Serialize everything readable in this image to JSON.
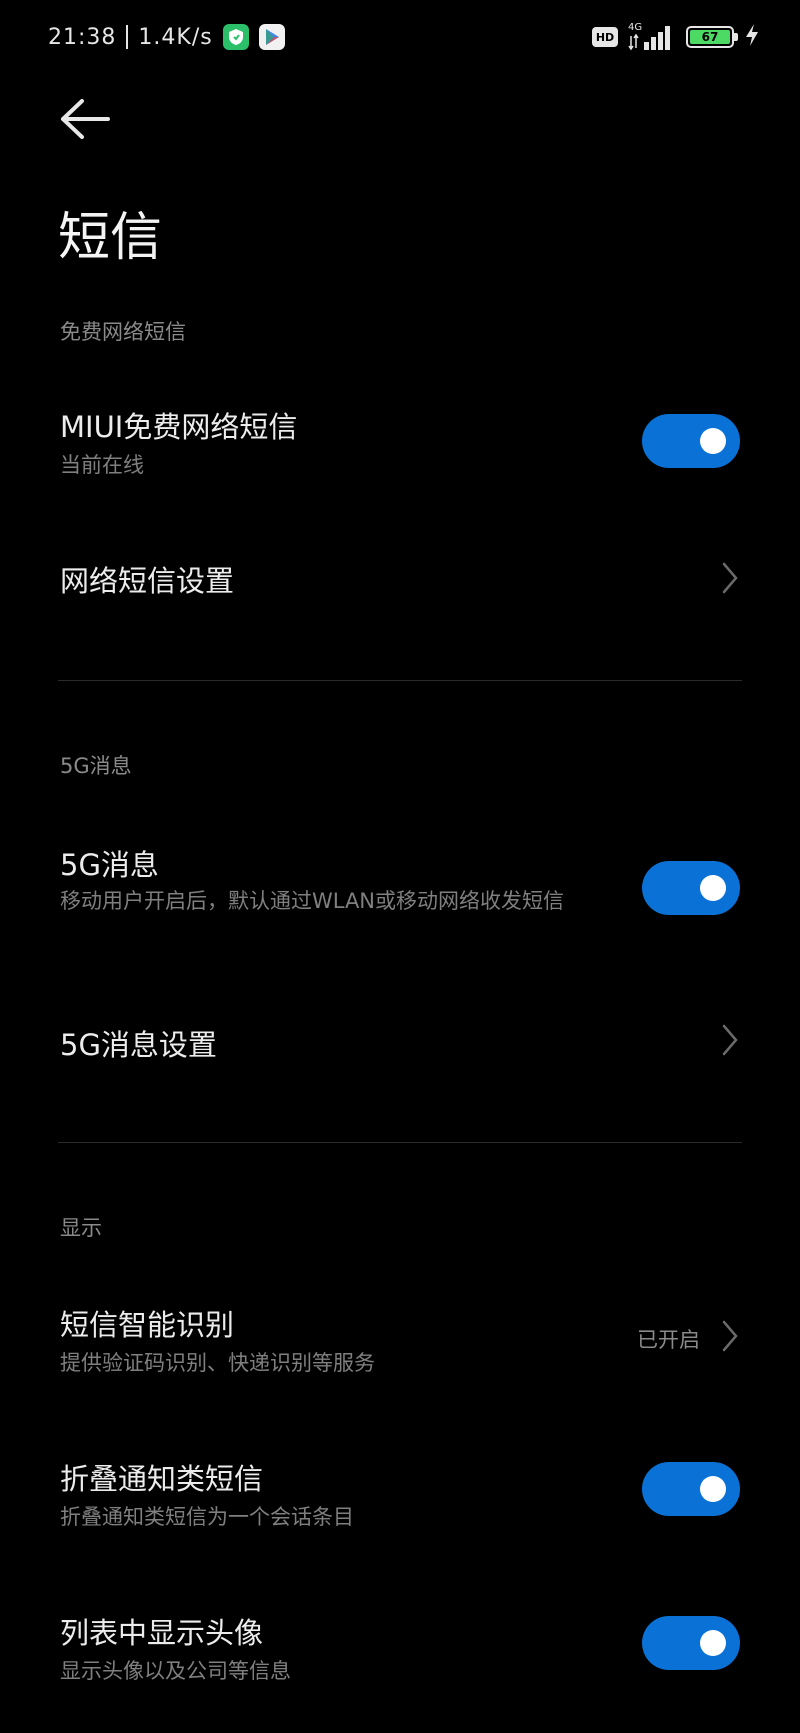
{
  "status_bar": {
    "time": "21:38",
    "speed": "1.4K/s",
    "network": "4G",
    "battery": "67",
    "hd": "HD"
  },
  "header": {
    "title": "短信"
  },
  "sections": {
    "free_sms": {
      "label": "免费网络短信",
      "miui_title": "MIUI免费网络短信",
      "miui_sub": "当前在线",
      "miui_on": true,
      "settings_title": "网络短信设置"
    },
    "fiveg": {
      "label": "5G消息",
      "fiveg_title": "5G消息",
      "fiveg_sub": "移动用户开启后，默认通过WLAN或移动网络收发短信",
      "fiveg_on": true,
      "settings_title": "5G消息设置"
    },
    "display": {
      "label": "显示",
      "smart_title": "短信智能识别",
      "smart_sub": "提供验证码识别、快递识别等服务",
      "smart_value": "已开启",
      "fold_title": "折叠通知类短信",
      "fold_sub": "折叠通知类短信为一个会话条目",
      "fold_on": true,
      "avatar_title": "列表中显示头像",
      "avatar_sub": "显示头像以及公司等信息",
      "avatar_on": true
    }
  },
  "colors": {
    "accent": "#0a72d6",
    "background": "#000000"
  }
}
